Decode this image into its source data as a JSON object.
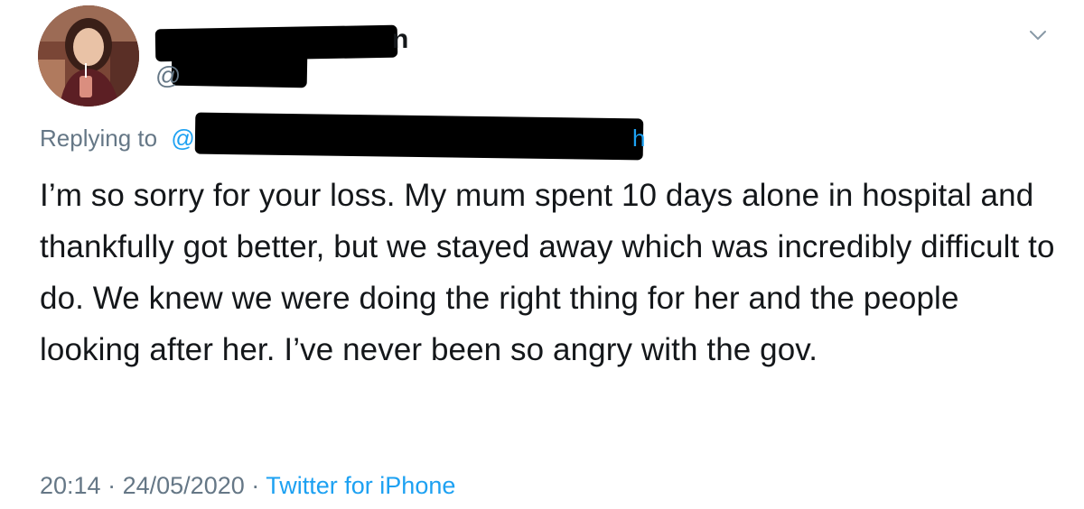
{
  "tweet": {
    "avatar_icon": "profile-photo",
    "name_visible_tail": "n",
    "handle_visible_head": "@",
    "reply_label": "Replying to",
    "reply_handle_head": "@",
    "reply_handle_tail": "h",
    "body": "I’m so sorry for your loss. My mum spent 10 days alone in hospital and thankfully got better, but we stayed away which was incredibly difficult to do. We knew we were doing the right thing for her and the people looking after her. I’ve never been so angry with the gov.",
    "time": "20:14",
    "date": "24/05/2020",
    "separator": "·",
    "source": "Twitter for iPhone",
    "chevron_icon": "chevron-down-icon",
    "colors": {
      "text": "#14171a",
      "secondary": "#657786",
      "link": "#1da1f2",
      "redaction": "#000000"
    }
  }
}
